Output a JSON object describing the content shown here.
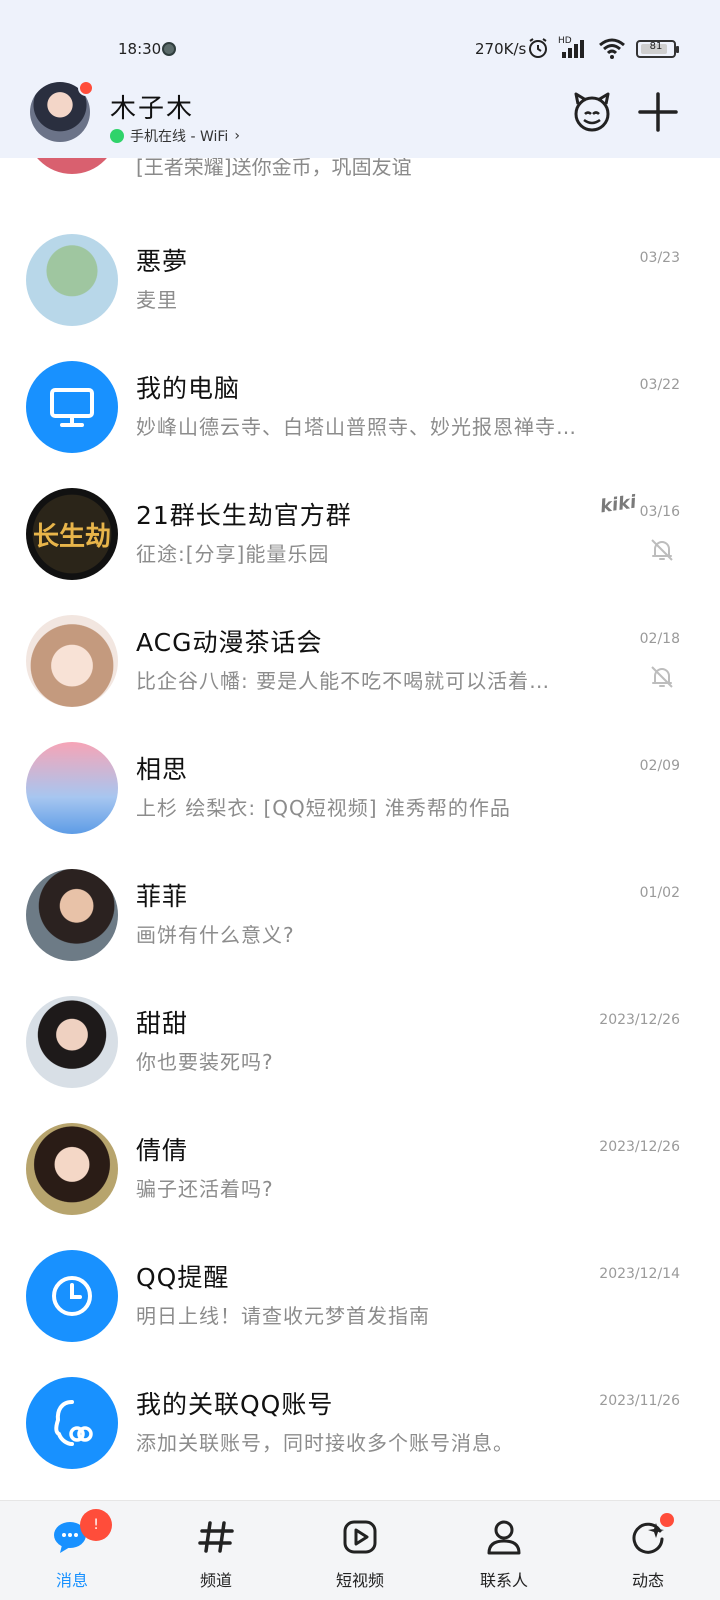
{
  "status_bar": {
    "time": "18:30",
    "net_speed": "270K/s",
    "battery": "81",
    "battery_level": 0.81
  },
  "header": {
    "name": "木子木",
    "status_text": "手机在线 - WiFi"
  },
  "partial_item": {
    "preview": "[王者荣耀]送你金币，巩固友谊"
  },
  "chats": [
    {
      "name": "悪夢",
      "preview": "麦里",
      "date": "03/23",
      "muted": false,
      "avatar": "sponge"
    },
    {
      "name": "我的电脑",
      "preview": "妙峰山德云寺、白塔山普照寺、妙光报恩禅寺…",
      "date": "03/22",
      "muted": false,
      "avatar": "computer"
    },
    {
      "name": "21群长生劫官方群",
      "preview": "征途:[分享]能量乐园",
      "date": "03/16",
      "muted": true,
      "avatar": "game",
      "avatar_text": "长生劫",
      "sticker": "kiki"
    },
    {
      "name": "ACG动漫茶话会",
      "preview": "比企谷八幡: 要是人能不吃不喝就可以活着…",
      "date": "02/18",
      "muted": true,
      "avatar": "anime"
    },
    {
      "name": "相思",
      "preview": "上杉 绘梨衣: [QQ短视频] 淮秀帮的作品",
      "date": "02/09",
      "muted": false,
      "avatar": "deer"
    },
    {
      "name": "菲菲",
      "preview": "画饼有什么意义?",
      "date": "01/02",
      "muted": false,
      "avatar": "photo1"
    },
    {
      "name": "甜甜",
      "preview": "你也要装死吗?",
      "date": "2023/12/26",
      "muted": false,
      "avatar": "photo2"
    },
    {
      "name": "倩倩",
      "preview": "骗子还活着吗?",
      "date": "2023/12/26",
      "muted": false,
      "avatar": "photo3"
    },
    {
      "name": "QQ提醒",
      "preview": "明日上线！请查收元梦首发指南",
      "date": "2023/12/14",
      "muted": false,
      "avatar": "clock"
    },
    {
      "name": "我的关联QQ账号",
      "preview": "添加关联账号，同时接收多个账号消息。",
      "date": "2023/11/26",
      "muted": false,
      "avatar": "link"
    }
  ],
  "bottom_nav": {
    "tabs": [
      {
        "label": "消息",
        "icon": "chat-bubble-icon",
        "active": true,
        "badge": "!"
      },
      {
        "label": "频道",
        "icon": "hash-icon",
        "active": false
      },
      {
        "label": "短视频",
        "icon": "video-play-icon",
        "active": false
      },
      {
        "label": "联系人",
        "icon": "person-icon",
        "active": false
      },
      {
        "label": "动态",
        "icon": "refresh-star-icon",
        "active": false,
        "dot": true
      }
    ]
  },
  "colors": {
    "accent": "#1891ff",
    "badge": "#ff4d3a",
    "online": "#2fd36a",
    "header_bg": "#eef2fb"
  }
}
